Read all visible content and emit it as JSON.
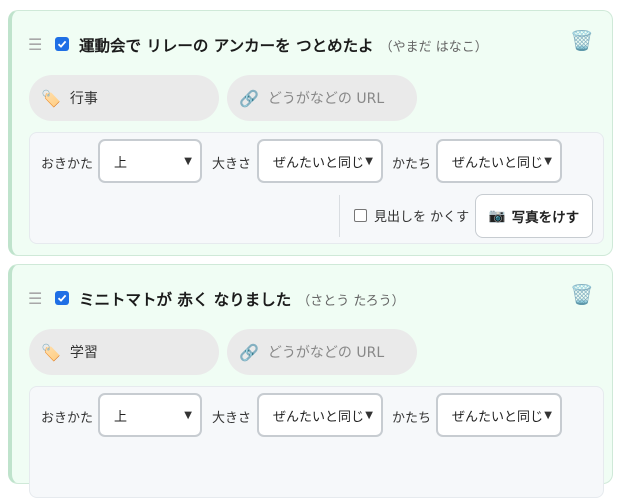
{
  "cards": [
    {
      "title": "運動会で リレーの アンカーを つとめたよ",
      "author": "（やまだ はなこ）",
      "checked": true,
      "category": "行事",
      "url_placeholder": "どうがなどの URL",
      "settings": {
        "align_label": "おきかた",
        "align_value": "上",
        "size_label": "大きさ",
        "size_value": "ぜんたいと同じ",
        "shape_label": "かたち",
        "shape_value": "ぜんたいと同じ",
        "hide_heading_label": "見出しを かくす",
        "remove_photo_label": "写真をけす"
      }
    },
    {
      "title": "ミニトマトが 赤く なりました",
      "author": "（さとう たろう）",
      "checked": true,
      "category": "学習",
      "url_placeholder": "どうがなどの URL",
      "settings": {
        "align_label": "おきかた",
        "align_value": "上",
        "size_label": "大きさ",
        "size_value": "ぜんたいと同じ",
        "shape_label": "かたち",
        "shape_value": "ぜんたいと同じ"
      }
    }
  ],
  "icons": {
    "drag_handle": "☰",
    "trash": "🗑️",
    "tag": "🏷️",
    "link": "🔗",
    "camera": "📷",
    "chevron": "⌄"
  },
  "colors": {
    "card_bg": "#f0fdf4",
    "card_border": "#bfe3cc",
    "checkbox_accent": "#1f6fe5"
  }
}
